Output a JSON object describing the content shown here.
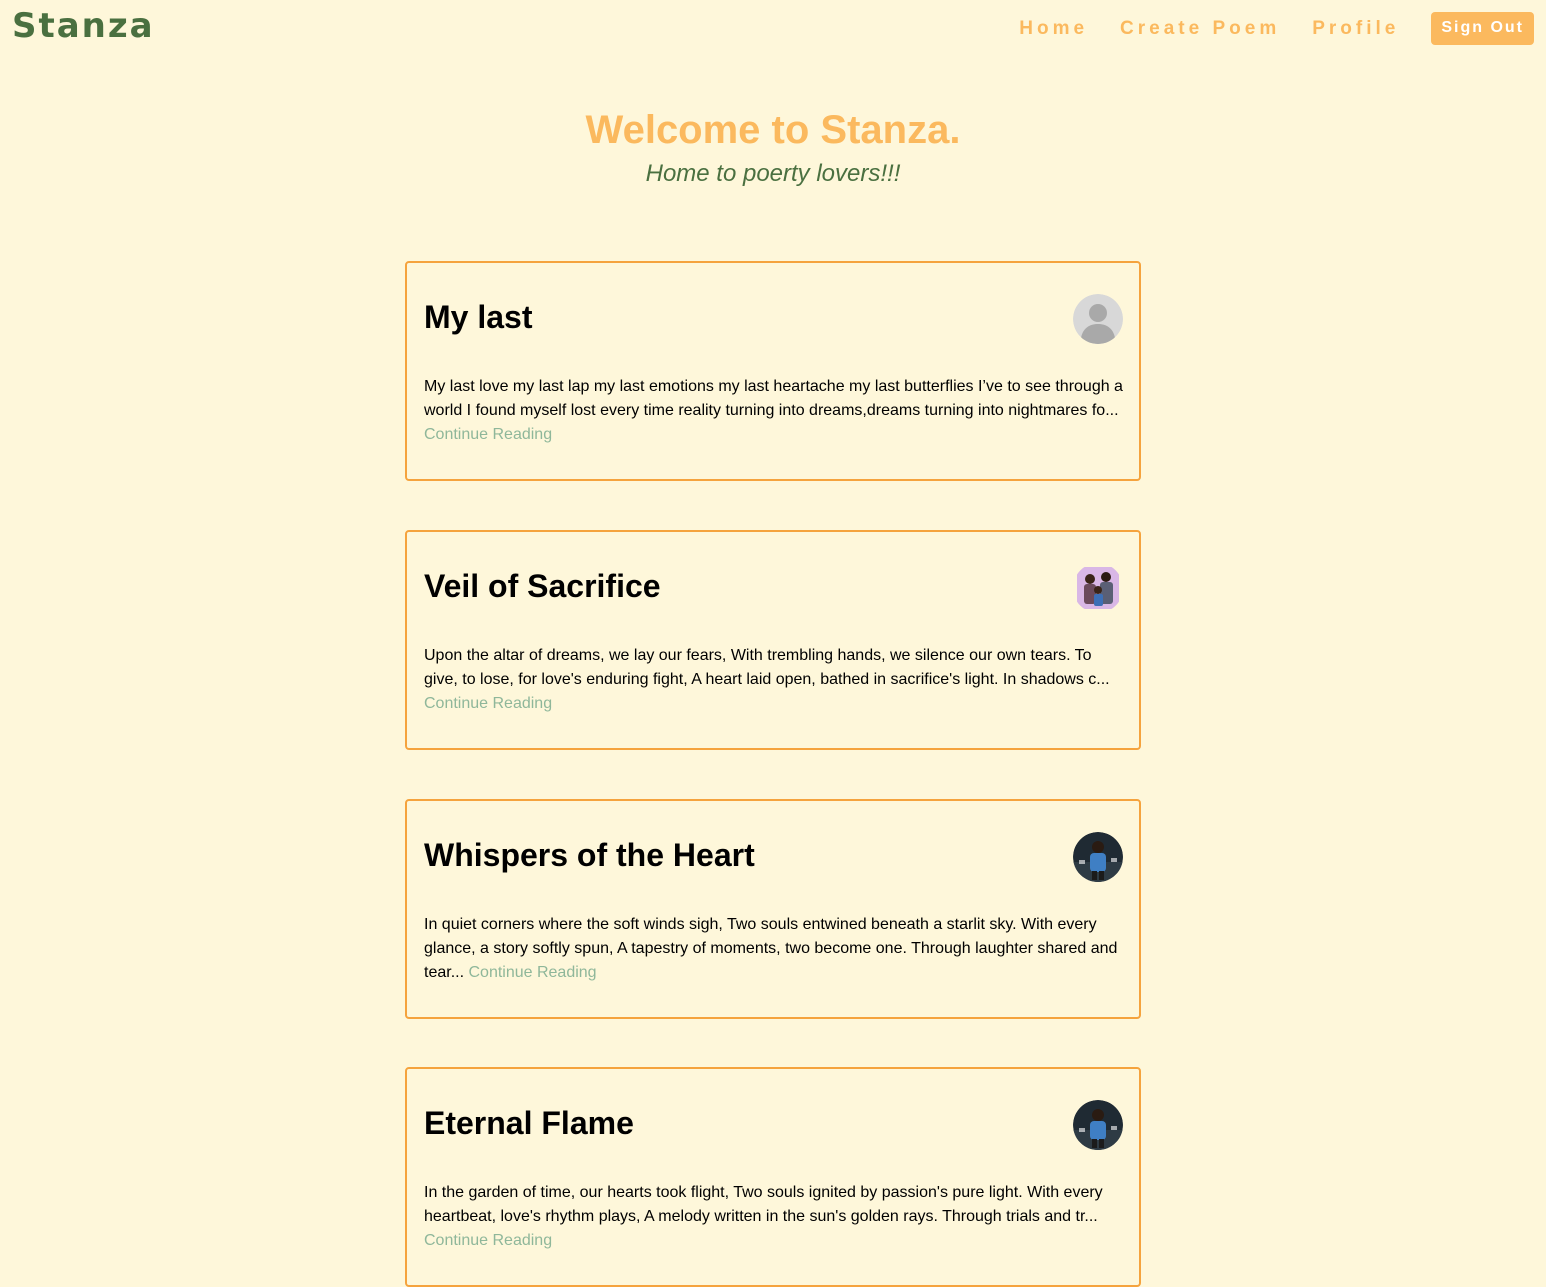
{
  "header": {
    "brand": "Stanza",
    "nav": {
      "home": "Home",
      "create": "Create Poem",
      "profile": "Profile",
      "signout": "Sign Out"
    }
  },
  "hero": {
    "title": "Welcome to Stanza.",
    "subtitle": "Home to poerty lovers!!!"
  },
  "poems": [
    {
      "title": "My last",
      "excerpt": "My last love my last lap my last emotions my last heartache my last butterflies I’ve to see through a world I found myself lost every time reality turning into dreams,dreams turning into nightmares fo...",
      "link": "Continue Reading",
      "avatar": "default-user-avatar"
    },
    {
      "title": "Veil of Sacrifice",
      "excerpt": "Upon the altar of dreams, we lay our fears, With trembling hands, we silence our own tears. To give, to lose, for love's enduring fight, A heart laid open, bathed in sacrifice's light. In shadows c...",
      "link": "Continue Reading",
      "avatar": "family-photo-avatar"
    },
    {
      "title": "Whispers of the Heart",
      "excerpt": "In quiet corners where the soft winds sigh, Two souls entwined beneath a starlit sky. With every glance, a story softly spun, A tapestry of moments, two become one. Through laughter shared and tear...",
      "link": "Continue Reading",
      "avatar": "person-photo-avatar"
    },
    {
      "title": "Eternal Flame",
      "excerpt": "In the garden of time, our hearts took flight, Two souls ignited by passion's pure light. With every heartbeat, love's rhythm plays, A melody written in the sun's golden rays. Through trials and tr...",
      "link": "Continue Reading",
      "avatar": "person-photo-avatar"
    }
  ]
}
